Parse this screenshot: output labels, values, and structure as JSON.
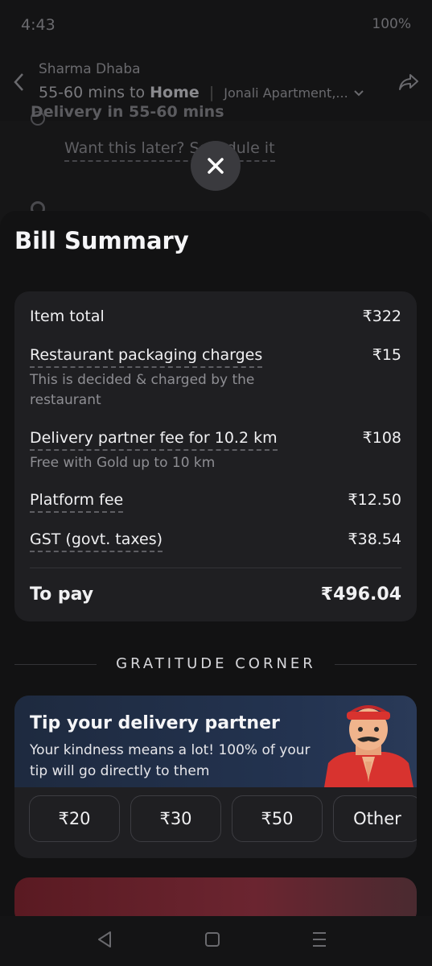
{
  "status": {
    "time": "4:43",
    "battery": "100%"
  },
  "appbar": {
    "restaurant": "Sharma Dhaba",
    "eta": "55-60 mins to ",
    "eta_dest": "Home",
    "address": "Jonali Apartment,..."
  },
  "background": {
    "delivery_text": "Delivery in 55-60 mins",
    "later_text": "Want this later? Schedule it"
  },
  "sheet": {
    "title": "Bill Summary",
    "bill": {
      "item_total_label": "Item total",
      "item_total_amount": "₹322",
      "packaging_label": "Restaurant packaging charges",
      "packaging_amount": "₹15",
      "packaging_note": "This is decided & charged by the restaurant",
      "delivery_label": "Delivery partner fee for 10.2 km",
      "delivery_amount": "₹108",
      "delivery_note": "Free with Gold up to 10 km",
      "platform_label": "Platform fee",
      "platform_amount": "₹12.50",
      "gst_label": "GST (govt. taxes)",
      "gst_amount": "₹38.54",
      "total_label": "To pay",
      "total_amount": "₹496.04"
    },
    "gratitude_heading": "GRATITUDE CORNER",
    "tip": {
      "title": "Tip your delivery partner",
      "subtitle": "Your kindness means a lot! 100% of your tip will go directly to them",
      "options": [
        "₹20",
        "₹30",
        "₹50",
        "Other"
      ]
    }
  },
  "icons": [
    "back-arrow-icon",
    "share-icon",
    "close-icon",
    "nav-back-icon",
    "nav-home-icon",
    "nav-recents-icon"
  ]
}
